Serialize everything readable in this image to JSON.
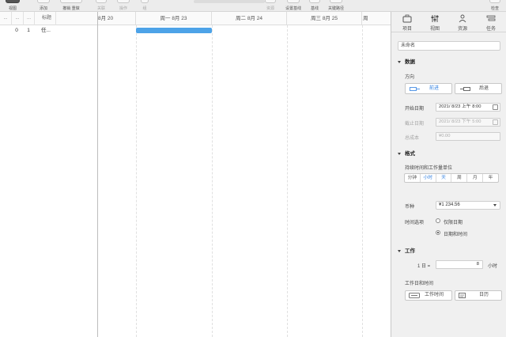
{
  "toolbar": {
    "buttons": [
      {
        "label": "视图",
        "dim": false
      },
      {
        "label": "添加",
        "dim": false
      },
      {
        "label": "撤销  重做",
        "dim": false
      },
      {
        "label": "关联",
        "dim": true
      },
      {
        "label": "操作",
        "dim": true
      },
      {
        "label": "组",
        "dim": true
      },
      {
        "label": "资源",
        "dim": true
      },
      {
        "label": "设置基线",
        "dim": false
      },
      {
        "label": "基线",
        "dim": false
      },
      {
        "label": "关键路径",
        "dim": false
      },
      {
        "label": "检查",
        "dim": false
      }
    ]
  },
  "outline": {
    "headers": [
      "...",
      "...",
      "...",
      "标题"
    ],
    "rows": [
      {
        "id": "0",
        "num": "1",
        "title": "任..."
      }
    ]
  },
  "gantt": {
    "columns": [
      "8月 20",
      "周一 8月 23",
      "周二 8月 24",
      "周三 8月 25",
      "周"
    ]
  },
  "inspector": {
    "tabs": [
      "项目",
      "视图",
      "资源",
      "任务"
    ],
    "name_value": "未命名",
    "data_section": "数据",
    "direction_label": "方向",
    "forward_label": "前进",
    "backward_label": "后退",
    "start_label": "开始日期",
    "start_value": "2021/ 8/23 上午 8:00",
    "end_label": "截止日期",
    "end_value": "2021/ 8/23 下午 5:00",
    "cost_label": "总成本",
    "cost_value": "¥0.00",
    "format_section": "格式",
    "duration_units_label": "持续时间和工作量单位",
    "units": [
      {
        "label": "分钟",
        "active": false
      },
      {
        "label": "小时",
        "active": true
      },
      {
        "label": "天",
        "active": true
      },
      {
        "label": "周",
        "active": false
      },
      {
        "label": "月",
        "active": false
      },
      {
        "label": "年",
        "active": false
      }
    ],
    "currency_label": "币种",
    "currency_value": "¥1 234.56",
    "time_options_label": "时间选项",
    "date_only_label": "仅限日期",
    "date_time_label": "日期和时间",
    "work_section": "工作",
    "day_equals_label": "1 日 =",
    "hours_value": "8",
    "hours_unit": "小时",
    "work_days_label": "工作日和时间",
    "work_time_button": "工作时间",
    "calendar_button": "日历"
  }
}
